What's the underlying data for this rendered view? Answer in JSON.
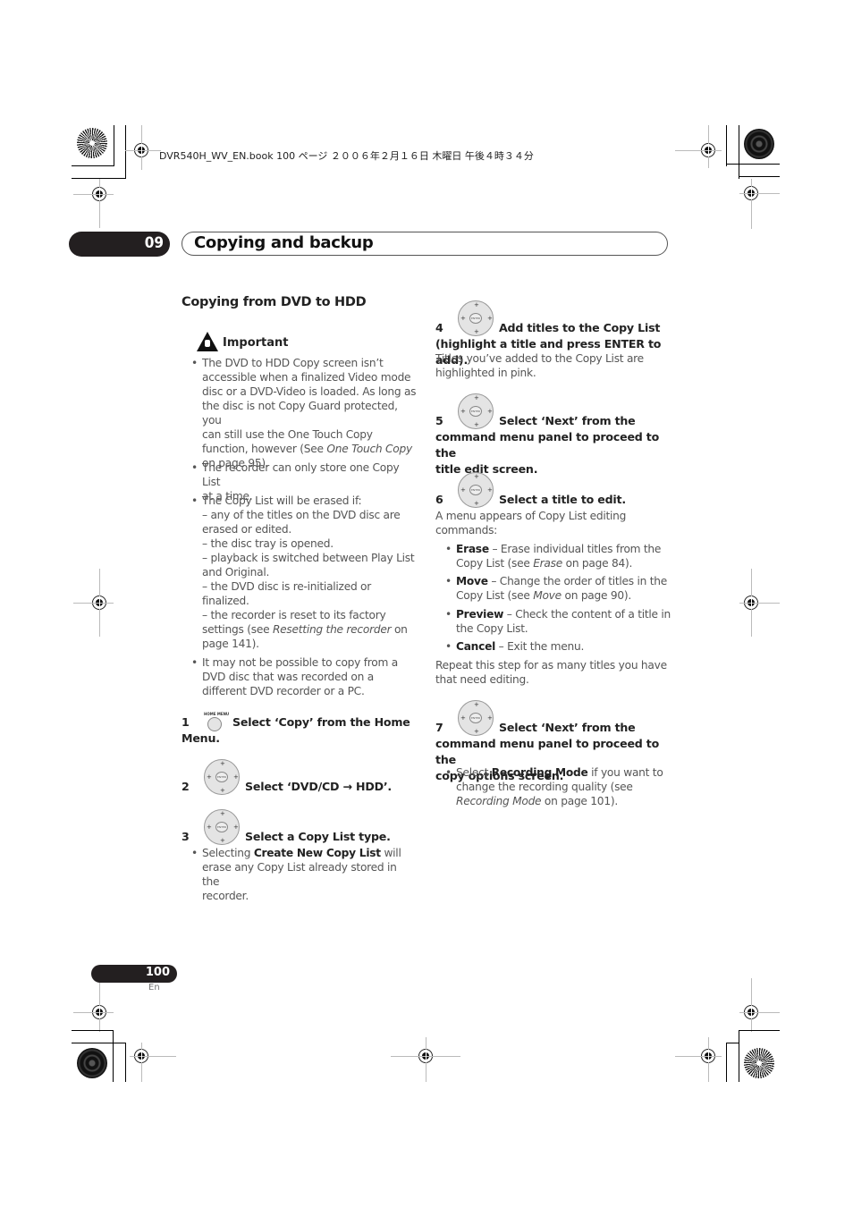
{
  "print_header": {
    "file_info": "DVR540H_WV_EN.book  100 ページ  ２００６年２月１６日  木曜日  午後４時３４分"
  },
  "chapter": {
    "number": "09",
    "title": "Copying and backup"
  },
  "section": {
    "heading": "Copying from DVD to HDD"
  },
  "important": {
    "icon": "warning-hand-icon",
    "label": "Important",
    "bullets": [
      {
        "lines": [
          "The DVD to HDD Copy screen isn’t",
          "accessible when a finalized Video mode",
          "disc or a DVD-Video is loaded. As long as",
          "the disc is not Copy Guard protected, you",
          "can still use the One Touch Copy",
          "function, however (See ",
          "on page 95)."
        ],
        "ref_italic": "One Touch Copy"
      },
      {
        "lines": [
          "The recorder can only store one Copy List",
          "at a time."
        ]
      },
      {
        "lines": [
          "The Copy List will be erased if:",
          "– any of the titles on the DVD disc are",
          "erased or edited.",
          "– the disc tray is opened.",
          "– playback is switched between Play List",
          "and Original.",
          "– the DVD disc is re-initialized or",
          "finalized.",
          "– the recorder is reset to its factory",
          "settings (see ",
          " on",
          "page 141)."
        ],
        "ref_italic": "Resetting the recorder"
      },
      {
        "lines": [
          "It may not be possible to copy from a",
          "DVD disc that was recorded on a",
          "different DVD recorder or a PC."
        ]
      }
    ]
  },
  "steps": [
    {
      "num": "1",
      "button": "home-menu-button",
      "button_label": "HOME MENU",
      "text_a": "Select ‘Copy’ from the Home",
      "text_b": "Menu."
    },
    {
      "num": "2",
      "button": "dpad-enter",
      "text_a": "Select ‘DVD/CD → HDD’."
    },
    {
      "num": "3",
      "button": "dpad-enter",
      "text_a": "Select a Copy List type.",
      "note_pre": "Selecting ",
      "note_bold": "Create New Copy List",
      "note_post": " will",
      "note_lines": [
        "erase any Copy List already stored in the",
        "recorder."
      ]
    },
    {
      "num": "4",
      "button": "dpad-enter",
      "text_a": "Add titles to the Copy List",
      "text_b": "(highlight a title and press ENTER to add).",
      "desc": [
        "Titles you’ve added to the Copy List are",
        "highlighted in pink."
      ]
    },
    {
      "num": "5",
      "button": "dpad-enter",
      "text_a": "Select ‘Next’ from the",
      "text_b": "command menu panel to proceed to the",
      "text_c": "title edit screen."
    },
    {
      "num": "6",
      "button": "dpad-enter",
      "text_a": "Select a title to edit.",
      "desc": [
        "A menu appears of Copy List editing",
        "commands:"
      ],
      "commands": [
        {
          "name": "Erase",
          "text": " – Erase individual titles from the",
          "line2_pre": "Copy List (see ",
          "line2_ital": "Erase",
          "line2_post": " on page 84)."
        },
        {
          "name": "Move",
          "text": " – Change the order of titles in the",
          "line2_pre": "Copy List (see ",
          "line2_ital": "Move",
          "line2_post": " on page 90)."
        },
        {
          "name": "Preview",
          "text": " – Check the content of a title in",
          "line2_pre": "the Copy List.",
          "line2_ital": "",
          "line2_post": ""
        },
        {
          "name": "Cancel",
          "text": " – Exit the menu."
        }
      ],
      "footer": [
        "Repeat this step for as many titles you have",
        "that need editing."
      ]
    },
    {
      "num": "7",
      "button": "dpad-enter",
      "text_a": "Select ‘Next’ from the",
      "text_b": "command menu panel to proceed to the",
      "text_c": "copy options screen.",
      "note_pre": "Select ",
      "note_bold": "Recording Mode",
      "note_post": " if you want to",
      "note_line2": "change the recording quality (see",
      "note_line3_ital": "Recording Mode",
      "note_line3_post": " on page 101)."
    }
  ],
  "dpad": {
    "enter_label": "ENTER"
  },
  "footer": {
    "page_number": "100",
    "language": "En"
  }
}
